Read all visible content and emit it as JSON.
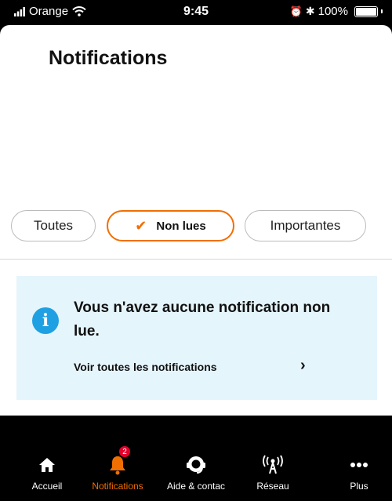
{
  "status_bar": {
    "carrier": "Orange",
    "time": "9:45",
    "battery": "100%"
  },
  "header": {
    "title": "Notifications"
  },
  "filters": [
    {
      "label": "Toutes",
      "active": false
    },
    {
      "label": "Non lues",
      "active": true
    },
    {
      "label": "Importantes",
      "active": false
    }
  ],
  "info_card": {
    "icon": "info-icon",
    "message": "Vous n'avez aucune notification non lue.",
    "link": "Voir toutes les notifications"
  },
  "tabbar": {
    "items": [
      {
        "label": "Accueil",
        "icon": "home-icon"
      },
      {
        "label": "Notifications",
        "icon": "bell-icon",
        "badge": "2",
        "active": true
      },
      {
        "label": "Aide & contac",
        "icon": "support-icon"
      },
      {
        "label": "Réseau",
        "icon": "antenna-icon"
      },
      {
        "label": "Plus",
        "icon": "more-icon"
      }
    ]
  },
  "colors": {
    "accent": "#f16e00",
    "info": "#1fa0e3",
    "info_bg": "#e5f5fc",
    "badge": "#e4002b"
  }
}
